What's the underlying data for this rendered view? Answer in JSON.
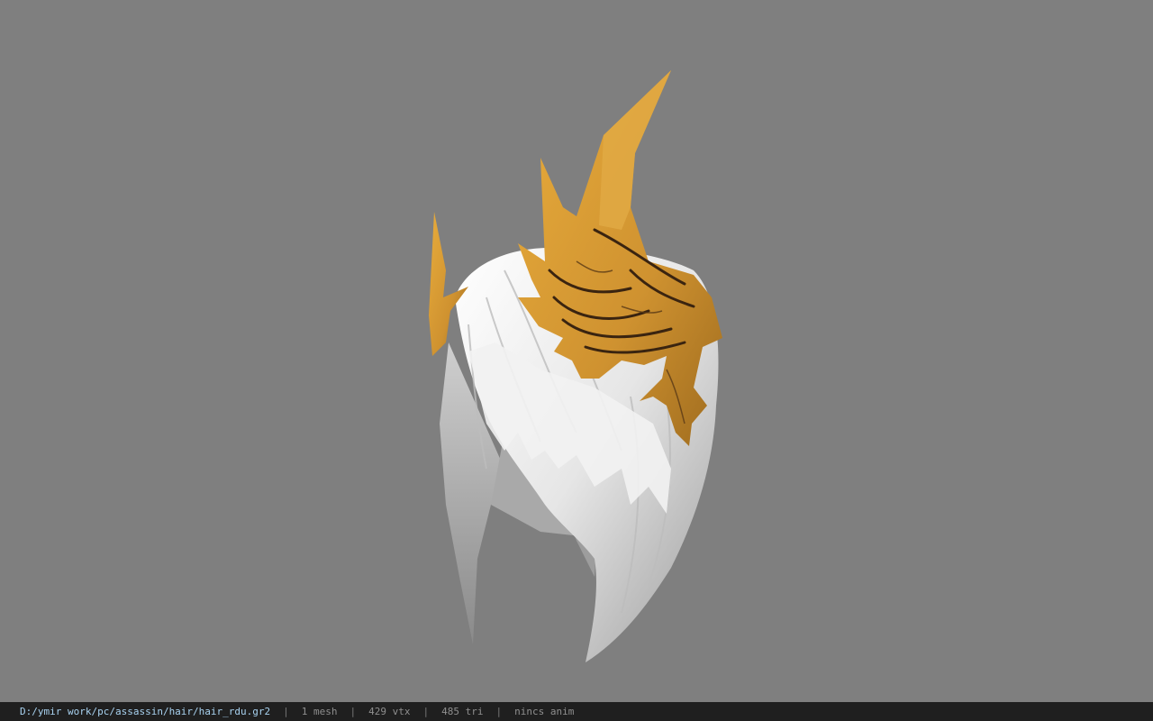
{
  "colors": {
    "viewport_bg": "#7f7f7f",
    "statusbar_bg": "#1f1f1f",
    "path_text": "#a8d2f0",
    "stat_text": "#8f8f8f",
    "hair": "#e8e8e8",
    "crown": "#d6992e"
  },
  "model": {
    "icon": "hair-with-gold-crown-model"
  },
  "statusbar": {
    "path": "D:/ymir work/pc/assassin/hair/hair_rdu.gr2",
    "separator": "|",
    "mesh_count": "1 mesh",
    "vertex_count": "429 vtx",
    "triangle_count": "485 tri",
    "anim": "nincs anim"
  }
}
